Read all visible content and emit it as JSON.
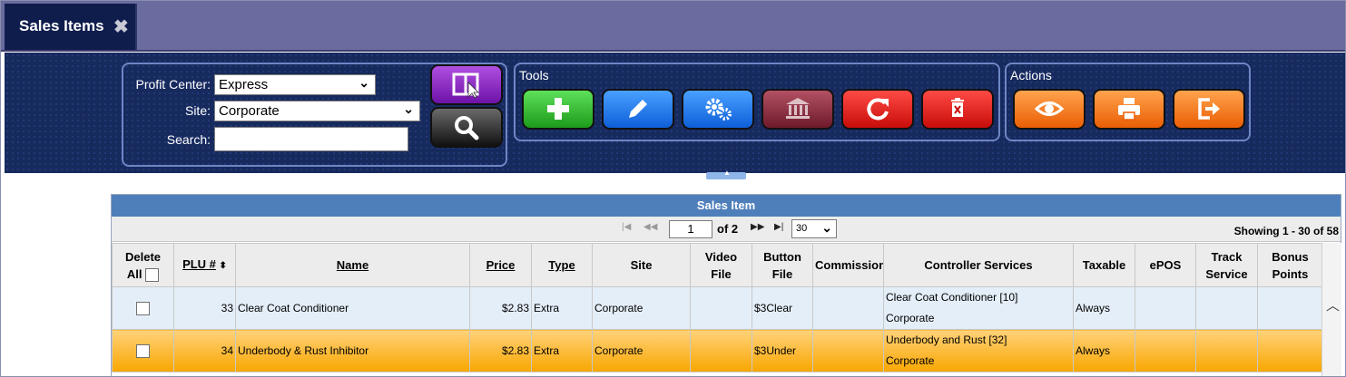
{
  "tab": {
    "label": "Sales Items",
    "close_icon": "close-icon"
  },
  "filters": {
    "profit_center_label": "Profit Center:",
    "profit_center_value": "Express",
    "site_label": "Site:",
    "site_value": "Corporate",
    "search_label": "Search:",
    "search_value": ""
  },
  "buttons": {
    "layout_icon": "layout-columns-icon",
    "search_icon": "search-icon"
  },
  "tools": {
    "label": "Tools",
    "items": [
      {
        "name": "add-icon",
        "color": "#1d9a1b"
      },
      {
        "name": "edit-pencil-icon",
        "color": "#0f5fd8"
      },
      {
        "name": "settings-gears-icon",
        "color": "#0f5fd8"
      },
      {
        "name": "institution-icon",
        "color": "#6e1a2c"
      },
      {
        "name": "refresh-icon",
        "color": "#c80d0a"
      },
      {
        "name": "delete-icon",
        "color": "#c80d0a"
      }
    ]
  },
  "actions": {
    "label": "Actions",
    "items": [
      {
        "name": "view-eye-icon",
        "color": "#ea5e05"
      },
      {
        "name": "print-icon",
        "color": "#ea5e05"
      },
      {
        "name": "export-icon",
        "color": "#ea5e05"
      }
    ]
  },
  "grid": {
    "title": "Sales Item",
    "pager": {
      "page": "1",
      "of": "of 2",
      "page_size": "30",
      "showing": "Showing 1 - 30 of 58"
    },
    "columns": {
      "delete": "Delete",
      "delete_all": "All",
      "plu": "PLU #",
      "name": "Name",
      "price": "Price",
      "type": "Type",
      "site": "Site",
      "video1": "Video",
      "video2": "File",
      "button1": "Button",
      "button2": "File",
      "commission": "Commission",
      "controller": "Controller Services",
      "taxable": "Taxable",
      "epos": "ePOS",
      "track1": "Track",
      "track2": "Service",
      "bonus1": "Bonus",
      "bonus2": "Points"
    },
    "rows": [
      {
        "plu": "33",
        "name": "Clear Coat Conditioner",
        "price": "$2.83",
        "type": "Extra",
        "site": "Corporate",
        "video_file": "",
        "button_file": "$3Clear",
        "commission": "",
        "controller_1": "Clear Coat Conditioner [10]",
        "controller_2": "Corporate",
        "taxable": "Always",
        "epos": "",
        "track_service": "",
        "bonus_points": ""
      },
      {
        "plu": "34",
        "name": "Underbody & Rust Inhibitor",
        "price": "$2.83",
        "type": "Extra",
        "site": "Corporate",
        "video_file": "",
        "button_file": "$3Under",
        "commission": "",
        "controller_1": "Underbody and Rust [32]",
        "controller_2": "Corporate",
        "taxable": "Always",
        "epos": "",
        "track_service": "",
        "bonus_points": ""
      }
    ]
  }
}
